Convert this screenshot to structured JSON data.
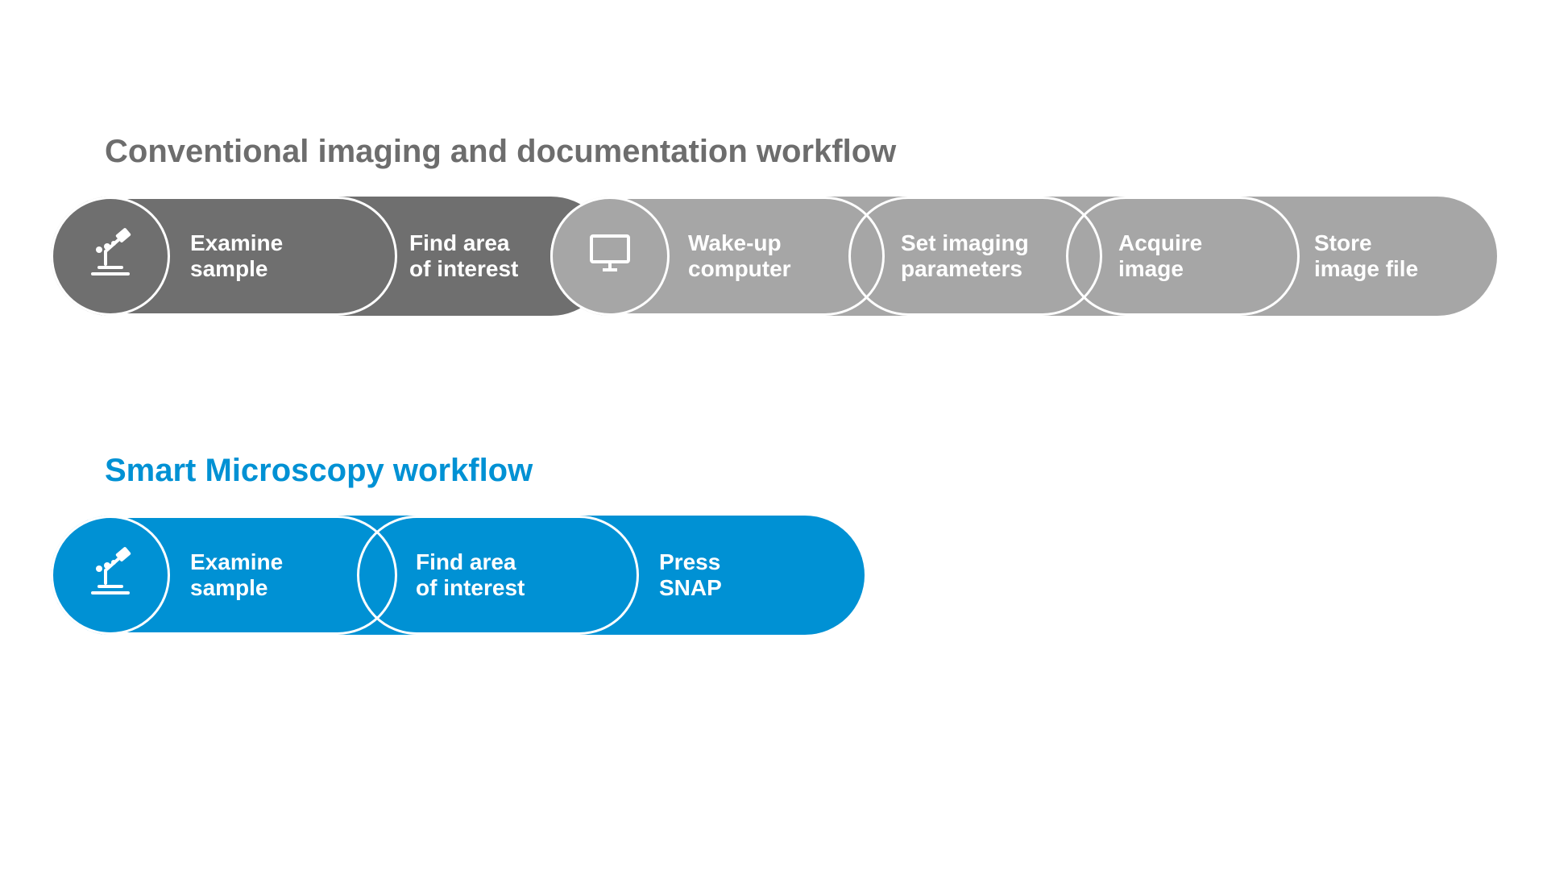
{
  "colors": {
    "darkGray": "#6f6f6f",
    "lightGray": "#a6a6a6",
    "blue": "#0091d4",
    "titleGray": "#6d6d6d"
  },
  "conventional": {
    "title": "Conventional imaging and documentation workflow",
    "steps": {
      "examine": "Examine\nsample",
      "findArea": "Find area\nof interest",
      "wakeUp": "Wake-up\ncomputer",
      "setParams": "Set imaging\nparameters",
      "acquire": "Acquire\nimage",
      "store": "Store\nimage file"
    }
  },
  "smart": {
    "title": "Smart Microscopy workflow",
    "steps": {
      "examine": "Examine\nsample",
      "findArea": "Find area\nof interest",
      "snap": "Press\nSNAP"
    }
  },
  "icons": {
    "microscope": "microscope-icon",
    "monitor": "monitor-icon"
  }
}
